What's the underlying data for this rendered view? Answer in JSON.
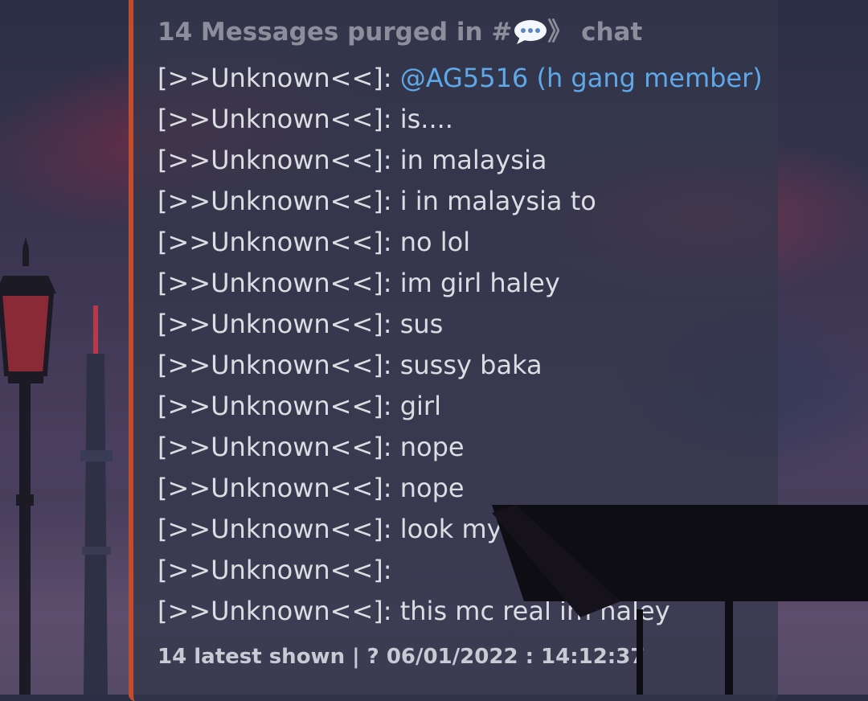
{
  "embed": {
    "accent_color": "#c24d2c",
    "title_prefix": "14 Messages purged in #",
    "title_icon": "speech-balloon-icon",
    "title_suffix": "》 chat",
    "messages": [
      {
        "author": "[>>Unknown<<]:",
        "text": "@AG5516 (h gang member)",
        "mention": true
      },
      {
        "author": "[>>Unknown<<]:",
        "text": "is...."
      },
      {
        "author": "[>>Unknown<<]:",
        "text": "in malaysia"
      },
      {
        "author": "[>>Unknown<<]:",
        "text": "i in malaysia to"
      },
      {
        "author": "[>>Unknown<<]:",
        "text": "no lol"
      },
      {
        "author": "[>>Unknown<<]:",
        "text": "im girl haley"
      },
      {
        "author": "[>>Unknown<<]:",
        "text": "sus"
      },
      {
        "author": "[>>Unknown<<]:",
        "text": "sussy baka"
      },
      {
        "author": "[>>Unknown<<]:",
        "text": "girl"
      },
      {
        "author": "[>>Unknown<<]:",
        "text": "nope"
      },
      {
        "author": "[>>Unknown<<]:",
        "text": "nope"
      },
      {
        "author": "[>>Unknown<<]:",
        "text": "look my real face in pc"
      },
      {
        "author": "[>>Unknown<<]:",
        "text": ""
      },
      {
        "author": "[>>Unknown<<]:",
        "text": "this mc real im haley"
      }
    ],
    "footer": "14 latest shown | ? 06/01/2022 : 14:12:37",
    "mention_color": "#5ea8e8"
  }
}
